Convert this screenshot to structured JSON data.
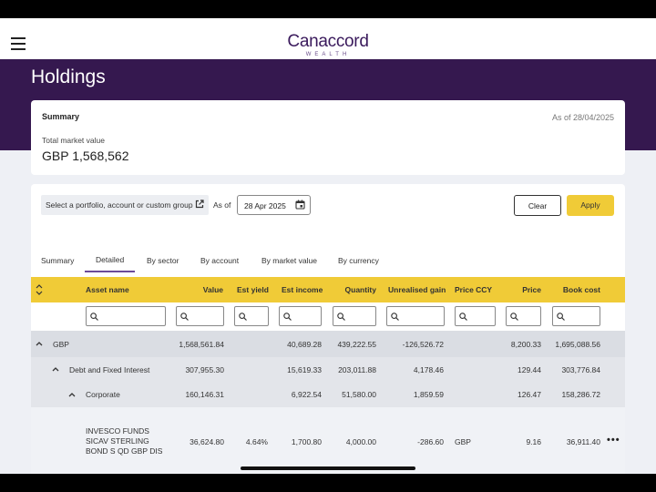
{
  "app": {
    "logo_main": "Canaccord",
    "logo_sub": "WEALTH"
  },
  "page": {
    "title": "Holdings"
  },
  "summary": {
    "label": "Summary",
    "as_of": "As of 28/04/2025",
    "total_label": "Total market value",
    "total_value": "GBP 1,568,562"
  },
  "filters": {
    "portfolio_select": "Select a portfolio, account or custom group",
    "as_of_label": "As of",
    "date_value": "28 Apr 2025",
    "clear_label": "Clear",
    "apply_label": "Apply"
  },
  "tabs": [
    "Summary",
    "Detailed",
    "By sector",
    "By account",
    "By market value",
    "By currency"
  ],
  "active_tab": "Detailed",
  "columns": {
    "asset_name": "Asset name",
    "value": "Value",
    "est_yield": "Est yield",
    "est_income": "Est income",
    "quantity": "Quantity",
    "unrealised_gain": "Unrealised gain",
    "price_ccy": "Price CCY",
    "price": "Price",
    "book_cost": "Book cost"
  },
  "rows": {
    "gbp": {
      "name": "GBP",
      "value": "1,568,561.84",
      "est_income": "40,689.28",
      "quantity": "439,222.55",
      "unrealised_gain": "-126,526.72",
      "price": "8,200.33",
      "book_cost": "1,695,088.56"
    },
    "debt": {
      "name": "Debt and Fixed Interest",
      "value": "307,955.30",
      "est_income": "15,619.33",
      "quantity": "203,011.88",
      "unrealised_gain": "4,178.46",
      "price": "129.44",
      "book_cost": "303,776.84"
    },
    "corporate": {
      "name": "Corporate",
      "value": "160,146.31",
      "est_income": "6,922.54",
      "quantity": "51,580.00",
      "unrealised_gain": "1,859.59",
      "price": "126.47",
      "book_cost": "158,286.72"
    },
    "invesco": {
      "name_line1": "INVESCO FUNDS",
      "name_line2": "SICAV STERLING",
      "name_line3": "BOND S QD GBP DIS",
      "value": "36,624.80",
      "est_yield": "4.64%",
      "est_income": "1,700.80",
      "quantity": "4,000.00",
      "unrealised_gain": "-286.60",
      "price_ccy": "GBP",
      "price": "9.16",
      "book_cost": "36,911.40",
      "more": "•••"
    }
  },
  "colors": {
    "brand_purple": "#35184f",
    "accent_yellow": "#f0cb37",
    "group_row": "#dadde3",
    "subgroup_row": "#e3e5ea",
    "page_bg": "#eef0f5"
  }
}
